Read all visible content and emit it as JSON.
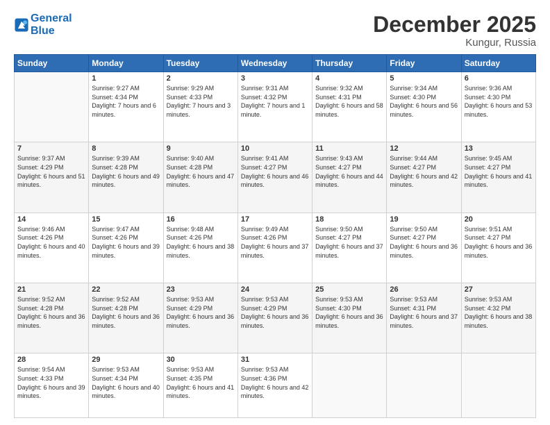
{
  "header": {
    "logo_line1": "General",
    "logo_line2": "Blue",
    "month": "December 2025",
    "location": "Kungur, Russia"
  },
  "days_of_week": [
    "Sunday",
    "Monday",
    "Tuesday",
    "Wednesday",
    "Thursday",
    "Friday",
    "Saturday"
  ],
  "weeks": [
    [
      {
        "day": "",
        "sunrise": "",
        "sunset": "",
        "daylight": ""
      },
      {
        "day": "1",
        "sunrise": "Sunrise: 9:27 AM",
        "sunset": "Sunset: 4:34 PM",
        "daylight": "Daylight: 7 hours and 6 minutes."
      },
      {
        "day": "2",
        "sunrise": "Sunrise: 9:29 AM",
        "sunset": "Sunset: 4:33 PM",
        "daylight": "Daylight: 7 hours and 3 minutes."
      },
      {
        "day": "3",
        "sunrise": "Sunrise: 9:31 AM",
        "sunset": "Sunset: 4:32 PM",
        "daylight": "Daylight: 7 hours and 1 minute."
      },
      {
        "day": "4",
        "sunrise": "Sunrise: 9:32 AM",
        "sunset": "Sunset: 4:31 PM",
        "daylight": "Daylight: 6 hours and 58 minutes."
      },
      {
        "day": "5",
        "sunrise": "Sunrise: 9:34 AM",
        "sunset": "Sunset: 4:30 PM",
        "daylight": "Daylight: 6 hours and 56 minutes."
      },
      {
        "day": "6",
        "sunrise": "Sunrise: 9:36 AM",
        "sunset": "Sunset: 4:30 PM",
        "daylight": "Daylight: 6 hours and 53 minutes."
      }
    ],
    [
      {
        "day": "7",
        "sunrise": "Sunrise: 9:37 AM",
        "sunset": "Sunset: 4:29 PM",
        "daylight": "Daylight: 6 hours and 51 minutes."
      },
      {
        "day": "8",
        "sunrise": "Sunrise: 9:39 AM",
        "sunset": "Sunset: 4:28 PM",
        "daylight": "Daylight: 6 hours and 49 minutes."
      },
      {
        "day": "9",
        "sunrise": "Sunrise: 9:40 AM",
        "sunset": "Sunset: 4:28 PM",
        "daylight": "Daylight: 6 hours and 47 minutes."
      },
      {
        "day": "10",
        "sunrise": "Sunrise: 9:41 AM",
        "sunset": "Sunset: 4:27 PM",
        "daylight": "Daylight: 6 hours and 46 minutes."
      },
      {
        "day": "11",
        "sunrise": "Sunrise: 9:43 AM",
        "sunset": "Sunset: 4:27 PM",
        "daylight": "Daylight: 6 hours and 44 minutes."
      },
      {
        "day": "12",
        "sunrise": "Sunrise: 9:44 AM",
        "sunset": "Sunset: 4:27 PM",
        "daylight": "Daylight: 6 hours and 42 minutes."
      },
      {
        "day": "13",
        "sunrise": "Sunrise: 9:45 AM",
        "sunset": "Sunset: 4:27 PM",
        "daylight": "Daylight: 6 hours and 41 minutes."
      }
    ],
    [
      {
        "day": "14",
        "sunrise": "Sunrise: 9:46 AM",
        "sunset": "Sunset: 4:26 PM",
        "daylight": "Daylight: 6 hours and 40 minutes."
      },
      {
        "day": "15",
        "sunrise": "Sunrise: 9:47 AM",
        "sunset": "Sunset: 4:26 PM",
        "daylight": "Daylight: 6 hours and 39 minutes."
      },
      {
        "day": "16",
        "sunrise": "Sunrise: 9:48 AM",
        "sunset": "Sunset: 4:26 PM",
        "daylight": "Daylight: 6 hours and 38 minutes."
      },
      {
        "day": "17",
        "sunrise": "Sunrise: 9:49 AM",
        "sunset": "Sunset: 4:26 PM",
        "daylight": "Daylight: 6 hours and 37 minutes."
      },
      {
        "day": "18",
        "sunrise": "Sunrise: 9:50 AM",
        "sunset": "Sunset: 4:27 PM",
        "daylight": "Daylight: 6 hours and 37 minutes."
      },
      {
        "day": "19",
        "sunrise": "Sunrise: 9:50 AM",
        "sunset": "Sunset: 4:27 PM",
        "daylight": "Daylight: 6 hours and 36 minutes."
      },
      {
        "day": "20",
        "sunrise": "Sunrise: 9:51 AM",
        "sunset": "Sunset: 4:27 PM",
        "daylight": "Daylight: 6 hours and 36 minutes."
      }
    ],
    [
      {
        "day": "21",
        "sunrise": "Sunrise: 9:52 AM",
        "sunset": "Sunset: 4:28 PM",
        "daylight": "Daylight: 6 hours and 36 minutes."
      },
      {
        "day": "22",
        "sunrise": "Sunrise: 9:52 AM",
        "sunset": "Sunset: 4:28 PM",
        "daylight": "Daylight: 6 hours and 36 minutes."
      },
      {
        "day": "23",
        "sunrise": "Sunrise: 9:53 AM",
        "sunset": "Sunset: 4:29 PM",
        "daylight": "Daylight: 6 hours and 36 minutes."
      },
      {
        "day": "24",
        "sunrise": "Sunrise: 9:53 AM",
        "sunset": "Sunset: 4:29 PM",
        "daylight": "Daylight: 6 hours and 36 minutes."
      },
      {
        "day": "25",
        "sunrise": "Sunrise: 9:53 AM",
        "sunset": "Sunset: 4:30 PM",
        "daylight": "Daylight: 6 hours and 36 minutes."
      },
      {
        "day": "26",
        "sunrise": "Sunrise: 9:53 AM",
        "sunset": "Sunset: 4:31 PM",
        "daylight": "Daylight: 6 hours and 37 minutes."
      },
      {
        "day": "27",
        "sunrise": "Sunrise: 9:53 AM",
        "sunset": "Sunset: 4:32 PM",
        "daylight": "Daylight: 6 hours and 38 minutes."
      }
    ],
    [
      {
        "day": "28",
        "sunrise": "Sunrise: 9:54 AM",
        "sunset": "Sunset: 4:33 PM",
        "daylight": "Daylight: 6 hours and 39 minutes."
      },
      {
        "day": "29",
        "sunrise": "Sunrise: 9:53 AM",
        "sunset": "Sunset: 4:34 PM",
        "daylight": "Daylight: 6 hours and 40 minutes."
      },
      {
        "day": "30",
        "sunrise": "Sunrise: 9:53 AM",
        "sunset": "Sunset: 4:35 PM",
        "daylight": "Daylight: 6 hours and 41 minutes."
      },
      {
        "day": "31",
        "sunrise": "Sunrise: 9:53 AM",
        "sunset": "Sunset: 4:36 PM",
        "daylight": "Daylight: 6 hours and 42 minutes."
      },
      {
        "day": "",
        "sunrise": "",
        "sunset": "",
        "daylight": ""
      },
      {
        "day": "",
        "sunrise": "",
        "sunset": "",
        "daylight": ""
      },
      {
        "day": "",
        "sunrise": "",
        "sunset": "",
        "daylight": ""
      }
    ]
  ]
}
